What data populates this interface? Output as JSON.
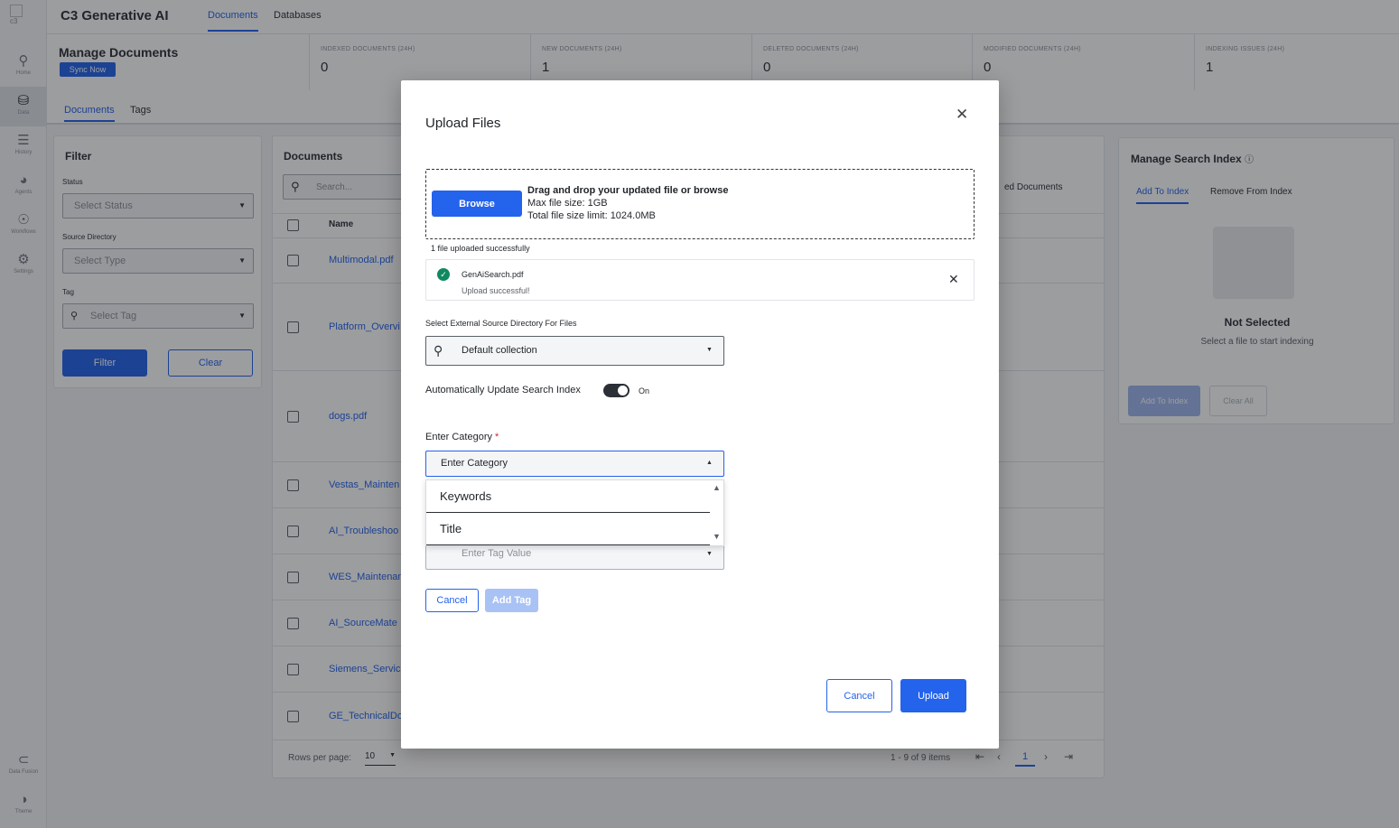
{
  "app": {
    "title": "C3 Generative AI",
    "logo_alt": "c3",
    "top_tabs": [
      "Documents",
      "Databases"
    ]
  },
  "rail": {
    "items": [
      {
        "label": "Home",
        "icon": "search-icon"
      },
      {
        "label": "Data",
        "icon": "database-icon"
      },
      {
        "label": "History",
        "icon": "history-icon"
      },
      {
        "label": "Agents",
        "icon": "agents-icon"
      },
      {
        "label": "Workflows",
        "icon": "workflow-icon"
      },
      {
        "label": "Settings",
        "icon": "settings-icon"
      }
    ],
    "bottom_items": [
      {
        "label": "Data Fusion",
        "icon": "share-icon"
      },
      {
        "label": "Theme",
        "icon": "toggle-icon"
      }
    ]
  },
  "header": {
    "page_title": "Manage Documents",
    "sync_label": "Sync Now",
    "stats": [
      {
        "label": "Indexed Documents (24h)",
        "value": "0"
      },
      {
        "label": "New Documents (24h)",
        "value": "1"
      },
      {
        "label": "Deleted Documents (24h)",
        "value": "0"
      },
      {
        "label": "Modified Documents (24h)",
        "value": "0"
      },
      {
        "label": "Indexing Issues (24h)",
        "value": "1"
      }
    ],
    "sub_tabs": [
      "Documents",
      "Tags"
    ]
  },
  "filter": {
    "title": "Filter",
    "status_label": "Status",
    "status_placeholder": "Select Status",
    "source_label": "Source Directory",
    "source_placeholder": "Select Type",
    "tag_label": "Tag",
    "tag_placeholder": "Select Tag",
    "filter_btn": "Filter",
    "clear_btn": "Clear"
  },
  "documents": {
    "title": "Documents",
    "search_placeholder": "Search...",
    "name_header": "Name",
    "partial_header": "ed Documents",
    "rows": [
      "Multimodal.pdf",
      "Platform_Overvi",
      "dogs.pdf",
      "Vestas_Mainten",
      "AI_Troubleshoo",
      "WES_Maintenan",
      "AI_SourceMate",
      "Siemens_Servic",
      "GE_TechnicalDo"
    ],
    "rows_per_page_label": "Rows per page:",
    "rows_per_page": "10",
    "range": "1 - 9 of 9 items",
    "page": "1"
  },
  "search_index": {
    "title": "Manage Search Index",
    "tabs": [
      "Add To Index",
      "Remove From Index"
    ],
    "empty_title": "Not Selected",
    "empty_sub": "Select a file to start indexing",
    "add_btn": "Add To Index",
    "clear_btn": "Clear All"
  },
  "modal": {
    "title": "Upload Files",
    "browse": "Browse",
    "drop_title": "Drag and drop your updated file or browse",
    "max_size": "Max file size: 1GB",
    "total_limit": "Total file size limit: 1024.0MB",
    "upload_count": "1 file uploaded successfully",
    "file_name": "GenAiSearch.pdf",
    "file_status": "Upload successful!",
    "source_label": "Select External Source Directory For Files",
    "source_value": "Default collection",
    "auto_update_label": "Automatically Update Search Index",
    "toggle_state": "On",
    "category_label": "Enter Category",
    "required_mark": "*",
    "category_placeholder": "Enter Category",
    "category_options": [
      "Keywords",
      "Title"
    ],
    "tag_value_placeholder": "Enter Tag Value",
    "cancel_small": "Cancel",
    "add_tag": "Add Tag",
    "cancel": "Cancel",
    "upload": "Upload"
  },
  "colors": {
    "accent": "#2463eb",
    "success": "#0f8a60",
    "overlay": "#14161a"
  }
}
